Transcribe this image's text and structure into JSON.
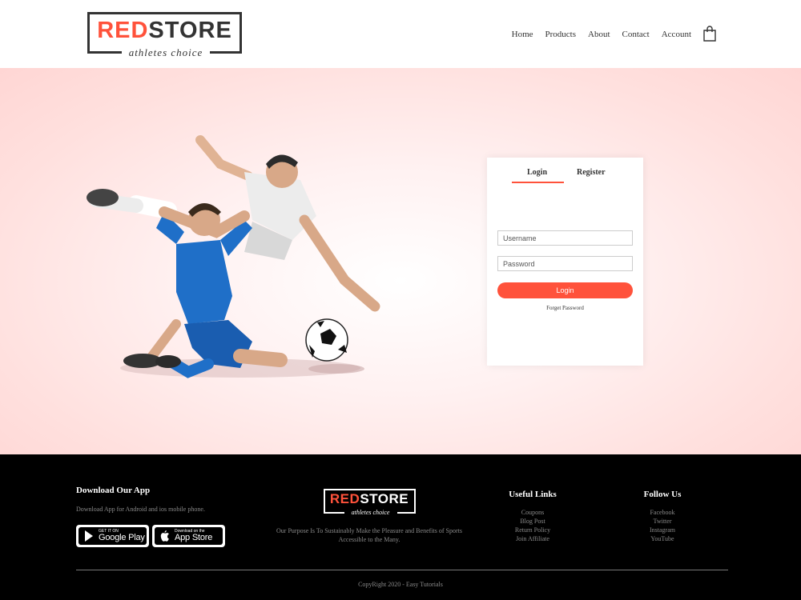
{
  "header": {
    "logo": {
      "red": "RED",
      "dark": "STORE",
      "tagline": "athletes choice"
    },
    "nav": [
      "Home",
      "Products",
      "About",
      "Contact",
      "Account"
    ],
    "cart_icon": "shopping-bag-icon"
  },
  "hero": {
    "image": "football-players-image",
    "form": {
      "tabs": {
        "login": "Login",
        "register": "Register"
      },
      "username_placeholder": "Username",
      "password_placeholder": "Password",
      "login_button": "Login",
      "forget_password": "Forget Password"
    }
  },
  "footer": {
    "download": {
      "title": "Download Our App",
      "text": "Download App for Android and ios mobile phone.",
      "google_play": {
        "small": "GET IT ON",
        "big": "Google Play"
      },
      "app_store": {
        "small": "Download on the",
        "big": "App Store"
      }
    },
    "brand": {
      "logo": {
        "red": "RED",
        "white": "STORE",
        "tagline": "athletes choice"
      },
      "purpose": "Our Purpose Is To Sustainably Make the Pleasure and Benefits of Sports Accessible to the Many."
    },
    "useful_links": {
      "title": "Useful Links",
      "items": [
        "Coupons",
        "Blog Post",
        "Return Policy",
        "Join Affiliate"
      ]
    },
    "follow_us": {
      "title": "Follow Us",
      "items": [
        "Facebook",
        "Twitter",
        "Instagram",
        "YouTube"
      ]
    },
    "copyright": "CopyRight 2020 - Easy Tutorials"
  },
  "colors": {
    "accent": "#ff523b",
    "footer_bg": "#000000",
    "hero_bg": "#ffd6d4"
  }
}
